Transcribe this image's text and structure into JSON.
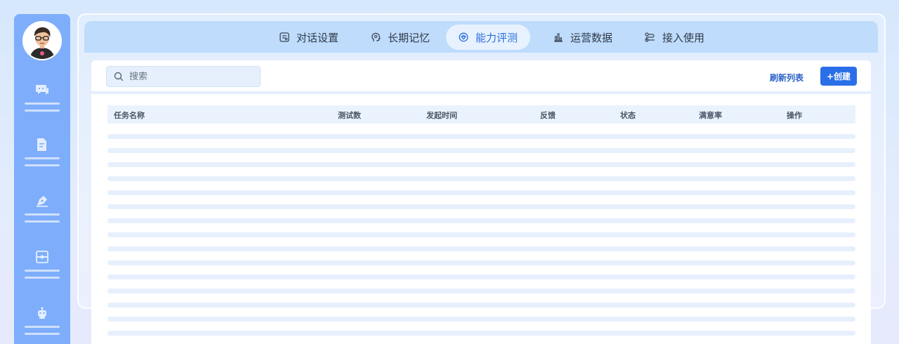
{
  "tabs": [
    {
      "label": "对话设置",
      "icon": "chat-settings-icon",
      "active": false
    },
    {
      "label": "长期记忆",
      "icon": "memory-head-icon",
      "active": false
    },
    {
      "label": "能力评测",
      "icon": "evaluation-icon",
      "active": true
    },
    {
      "label": "运营数据",
      "icon": "bar-chart-icon",
      "active": false
    },
    {
      "label": "接入使用",
      "icon": "integration-icon",
      "active": false
    }
  ],
  "search": {
    "placeholder": "搜索"
  },
  "toolbar": {
    "refresh_label": "刷新列表",
    "create_label": "+创建"
  },
  "table": {
    "columns": [
      "任务名称",
      "测试数",
      "发起时间",
      "反馈",
      "状态",
      "满意率",
      "操作"
    ],
    "loading_rows": 15
  },
  "sidebar": {
    "items": [
      "chat-icon",
      "document-edit-icon",
      "pen-icon",
      "media-icon",
      "robot-icon"
    ]
  },
  "colors": {
    "accent": "#2a6fe8",
    "sidebar": "#7eaefb",
    "tabbar": "#bfdcfc"
  }
}
